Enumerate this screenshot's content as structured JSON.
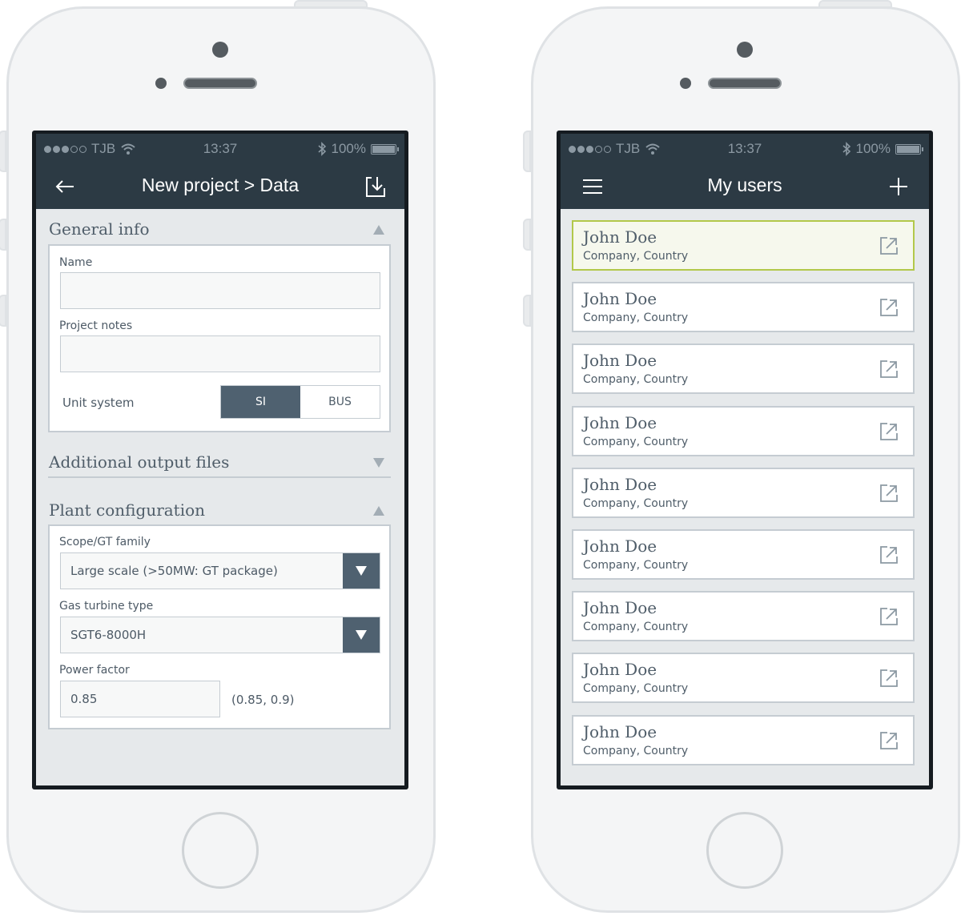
{
  "status_bar": {
    "carrier": "TJB",
    "time": "13:37",
    "battery": "100%",
    "battery_level": 1.0,
    "signal_bars_filled": 3,
    "signal_bars_total": 5
  },
  "left_screen": {
    "nav": {
      "title": "New project > Data",
      "back_icon": "arrow-left-icon",
      "action_icon": "download-icon"
    },
    "general_info": {
      "title": "General info",
      "expanded": true,
      "name_label": "Name",
      "name_value": "",
      "notes_label": "Project notes",
      "notes_value": "",
      "unit_system_label": "Unit system",
      "unit_options": [
        "SI",
        "BUS"
      ],
      "unit_selected": "SI"
    },
    "additional_output": {
      "title": "Additional output files",
      "expanded": false
    },
    "plant_config": {
      "title": "Plant configuration",
      "expanded": true,
      "scope_label": "Scope/GT family",
      "scope_value": "Large scale (>50MW: GT package)",
      "turbine_label": "Gas turbine type",
      "turbine_value": "SGT6-8000H",
      "power_factor_label": "Power factor",
      "power_factor_value": "0.85",
      "power_factor_range": "(0.85, 0.9)"
    }
  },
  "right_screen": {
    "nav": {
      "title": "My users",
      "menu_icon": "hamburger-menu-icon",
      "add_icon": "plus-icon"
    },
    "users": [
      {
        "name": "John Doe",
        "subtitle": "Company, Country",
        "selected": true
      },
      {
        "name": "John Doe",
        "subtitle": "Company, Country",
        "selected": false
      },
      {
        "name": "John Doe",
        "subtitle": "Company, Country",
        "selected": false
      },
      {
        "name": "John Doe",
        "subtitle": "Company, Country",
        "selected": false
      },
      {
        "name": "John Doe",
        "subtitle": "Company, Country",
        "selected": false
      },
      {
        "name": "John Doe",
        "subtitle": "Company, Country",
        "selected": false
      },
      {
        "name": "John Doe",
        "subtitle": "Company, Country",
        "selected": false
      },
      {
        "name": "John Doe",
        "subtitle": "Company, Country",
        "selected": false
      },
      {
        "name": "John Doe",
        "subtitle": "Company, Country",
        "selected": false
      }
    ]
  },
  "colors": {
    "nav_background": "#2c3a44",
    "accent": "#4f6170",
    "selected_border": "#b2c84a",
    "selected_background": "#f6f8ed",
    "screen_background": "#e6e9eb"
  }
}
